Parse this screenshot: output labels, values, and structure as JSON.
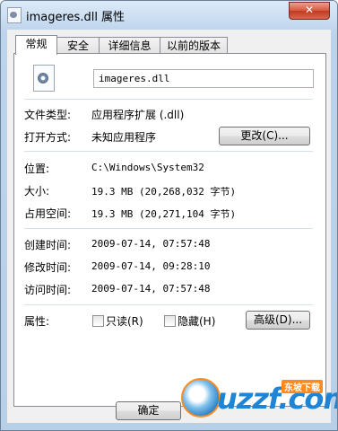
{
  "window": {
    "title": "imageres.dll 属性",
    "close_glyph": "✕"
  },
  "tabs": [
    {
      "label": "常规",
      "active": true
    },
    {
      "label": "安全",
      "active": false
    },
    {
      "label": "详细信息",
      "active": false
    },
    {
      "label": "以前的版本",
      "active": false
    }
  ],
  "general": {
    "file_name": "imageres.dll",
    "file_type_label": "文件类型:",
    "file_type_value": "应用程序扩展 (.dll)",
    "opens_with_label": "打开方式:",
    "opens_with_value": "未知应用程序",
    "change_button": "更改(C)...",
    "location_label": "位置:",
    "location_value": "C:\\Windows\\System32",
    "size_label": "大小:",
    "size_value": "19.3 MB (20,268,032 字节)",
    "size_on_disk_label": "占用空间:",
    "size_on_disk_value": "19.3 MB (20,271,104 字节)",
    "created_label": "创建时间:",
    "created_value": "2009-07-14, 07:57:48",
    "modified_label": "修改时间:",
    "modified_value": "2009-07-14, 09:28:10",
    "accessed_label": "访问时间:",
    "accessed_value": "2009-07-14, 07:57:48",
    "attributes_label": "属性:",
    "readonly_label": "只读(R)",
    "hidden_label": "隐藏(H)",
    "advanced_button": "高级(D)..."
  },
  "footer": {
    "ok_button": "确定"
  },
  "watermark": {
    "text": "uzzf.com",
    "badge": "东坡下载"
  },
  "icons": [
    "dll-file-icon",
    "close-icon",
    "gear-icon"
  ],
  "colors": {
    "title_bar": "#c2d7ee",
    "close_button": "#d9553c",
    "watermark_blue": "#1e84d6",
    "watermark_orange": "#ff8a1e"
  }
}
